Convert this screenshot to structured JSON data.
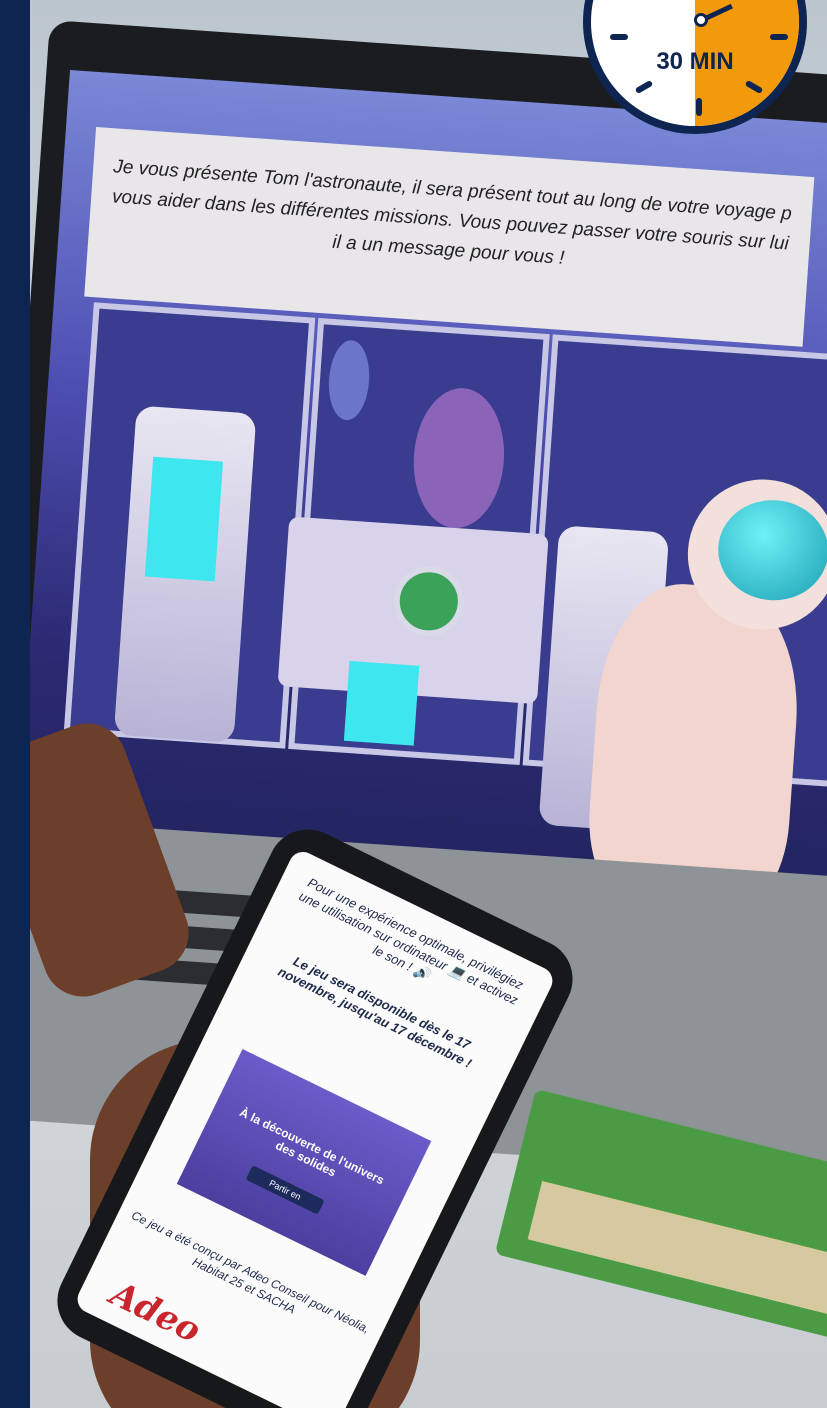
{
  "laptop_message": {
    "line1": "Je vous présente Tom l'astronaute, il sera présent tout au long de votre voyage p",
    "line2": "vous aider dans les différentes missions. Vous pouvez passer votre souris sur lui",
    "line3": "il a un message pour vous !"
  },
  "phone": {
    "intro": "Pour une expérience optimale, privilégiez une utilisation sur ordinateur 💻 et activez le son ! 🔊",
    "availability": "Le jeu sera disponible dès le 17 novembre, jusqu'au 17 décembre !",
    "banner_title": "À la découverte de l'univers des solides",
    "banner_button": "Partir en",
    "credit": "Ce jeu a été conçu par Adeo Conseil pour Néolia, Habitat 25 et SACHA",
    "logo": "Adeo"
  },
  "timer": {
    "label": "30 MIN"
  },
  "colors": {
    "navy": "#0d2550",
    "orange": "#f29a0c",
    "cyan": "#3ee6f0"
  }
}
